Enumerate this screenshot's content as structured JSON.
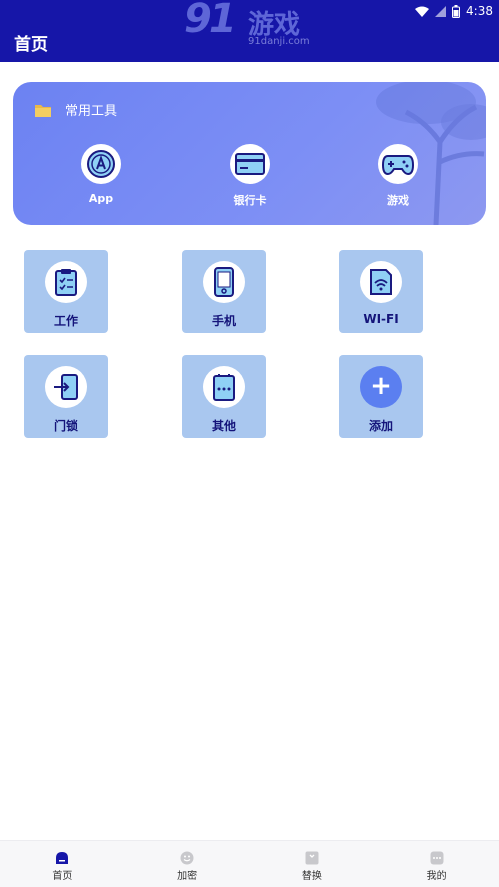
{
  "status_bar": {
    "time": "4:38"
  },
  "header": {
    "title": "首页",
    "watermark": {
      "number": "91",
      "text": "游戏",
      "url": "91danji.com"
    }
  },
  "tools": {
    "title": "常用工具",
    "items": [
      {
        "label": "App",
        "icon": "app-store-icon"
      },
      {
        "label": "银行卡",
        "icon": "bank-card-icon"
      },
      {
        "label": "游戏",
        "icon": "gamepad-icon"
      }
    ]
  },
  "grid": {
    "items": [
      {
        "label": "工作",
        "icon": "clipboard-icon"
      },
      {
        "label": "手机",
        "icon": "phone-icon"
      },
      {
        "label": "WI-FI",
        "icon": "wifi-card-icon"
      },
      {
        "label": "门锁",
        "icon": "door-lock-icon"
      },
      {
        "label": "其他",
        "icon": "other-icon"
      },
      {
        "label": "添加",
        "icon": "add-icon",
        "symbol": "+"
      }
    ]
  },
  "bottom_nav": {
    "items": [
      {
        "label": "首页",
        "active": true
      },
      {
        "label": "加密",
        "active": false
      },
      {
        "label": "替换",
        "active": false
      },
      {
        "label": "我的",
        "active": false
      }
    ]
  },
  "colors": {
    "header": "#1616a8",
    "card": "#7488f3",
    "tile": "#a9c7ef",
    "icon_dark": "#1a1a80",
    "add": "#5b7ff0"
  }
}
